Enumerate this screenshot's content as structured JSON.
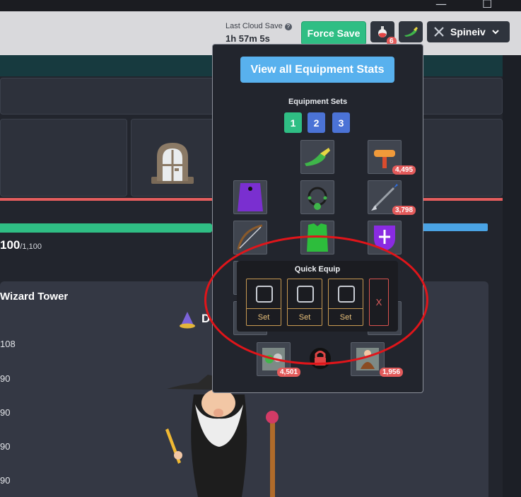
{
  "window": {
    "controls": [
      "—",
      "☐"
    ]
  },
  "header": {
    "cloud_label": "Last Cloud Save",
    "cloud_time": "1h 57m 5s",
    "force_save": "Force Save",
    "potion_badge": "6",
    "username": "Spineiv"
  },
  "background": {
    "hp_current": "100",
    "hp_max": "/1,100",
    "tower_title": "Wizard Tower",
    "tower_heading_partial": "D",
    "tower_values": [
      "108",
      "90",
      "90",
      "90",
      "90"
    ]
  },
  "panel": {
    "view_stats": "View all Equipment Stats",
    "sets_label": "Equipment Sets",
    "sets": [
      {
        "label": "1",
        "color": "#2fbe84"
      },
      {
        "label": "2",
        "color": "#4b73d6"
      },
      {
        "label": "3",
        "color": "#4b73d6"
      }
    ],
    "badges": {
      "pickaxe": "4,495",
      "arrows": "3,798",
      "food_left": "4,501",
      "food_right": "1,956"
    }
  },
  "quick_equip": {
    "title": "Quick Equip",
    "slots": [
      {
        "label": "Set"
      },
      {
        "label": "Set"
      },
      {
        "label": "Set"
      }
    ],
    "clear": "X"
  },
  "colors": {
    "accent_green": "#2fbe84",
    "accent_blue": "#58b1ee",
    "badge_red": "#e35b5b",
    "highlight_circle": "#e0151a"
  }
}
